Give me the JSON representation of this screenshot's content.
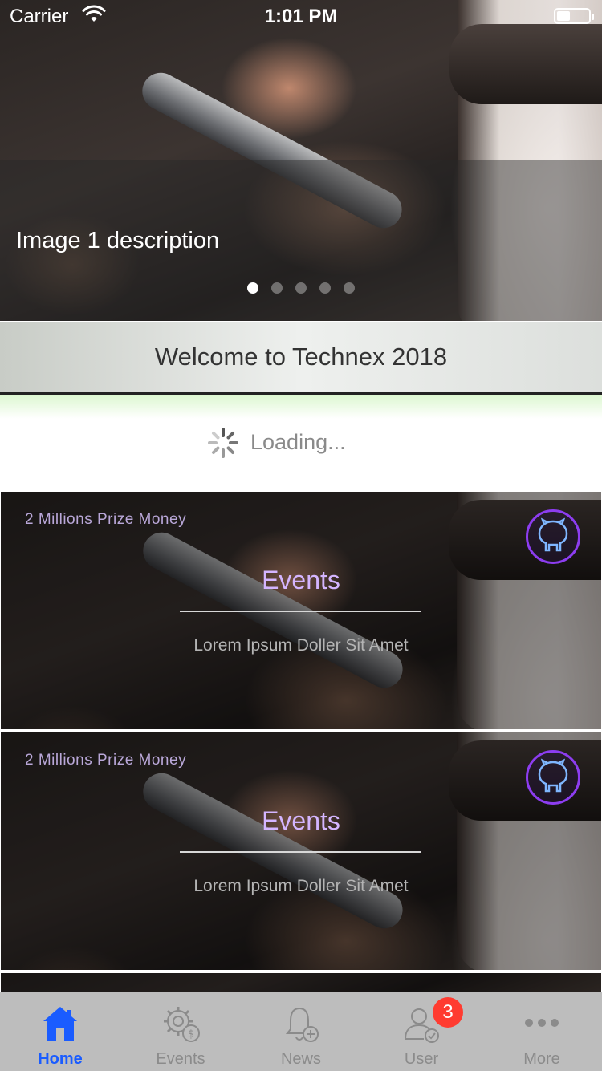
{
  "status_bar": {
    "carrier": "Carrier",
    "time": "1:01 PM"
  },
  "hero": {
    "caption": "Image 1 description",
    "slides_count": 5,
    "active_slide": 1
  },
  "welcome": {
    "title": "Welcome to Technex 2018"
  },
  "loading": {
    "text": "Loading..."
  },
  "cards": [
    {
      "prize": "2 Millions Prize Money",
      "title": "Events",
      "subtitle": "Lorem Ipsum Doller Sit Amet",
      "icon": "github-icon"
    },
    {
      "prize": "2 Millions Prize Money",
      "title": "Events",
      "subtitle": "Lorem Ipsum Doller Sit Amet",
      "icon": "github-icon"
    }
  ],
  "tabbar": {
    "items": [
      {
        "label": "Home",
        "icon": "home-icon",
        "active": true
      },
      {
        "label": "Events",
        "icon": "gear-dollar-icon",
        "active": false
      },
      {
        "label": "News",
        "icon": "bell-plus-icon",
        "active": false
      },
      {
        "label": "User",
        "icon": "user-check-icon",
        "active": false,
        "badge": "3"
      },
      {
        "label": "More",
        "icon": "more-dots-icon",
        "active": false
      }
    ]
  },
  "colors": {
    "accent": "#1a5cff",
    "card_title": "#d4b5ff",
    "badge": "#ff3b30",
    "tabbar_bg": "#bdbdbd"
  }
}
